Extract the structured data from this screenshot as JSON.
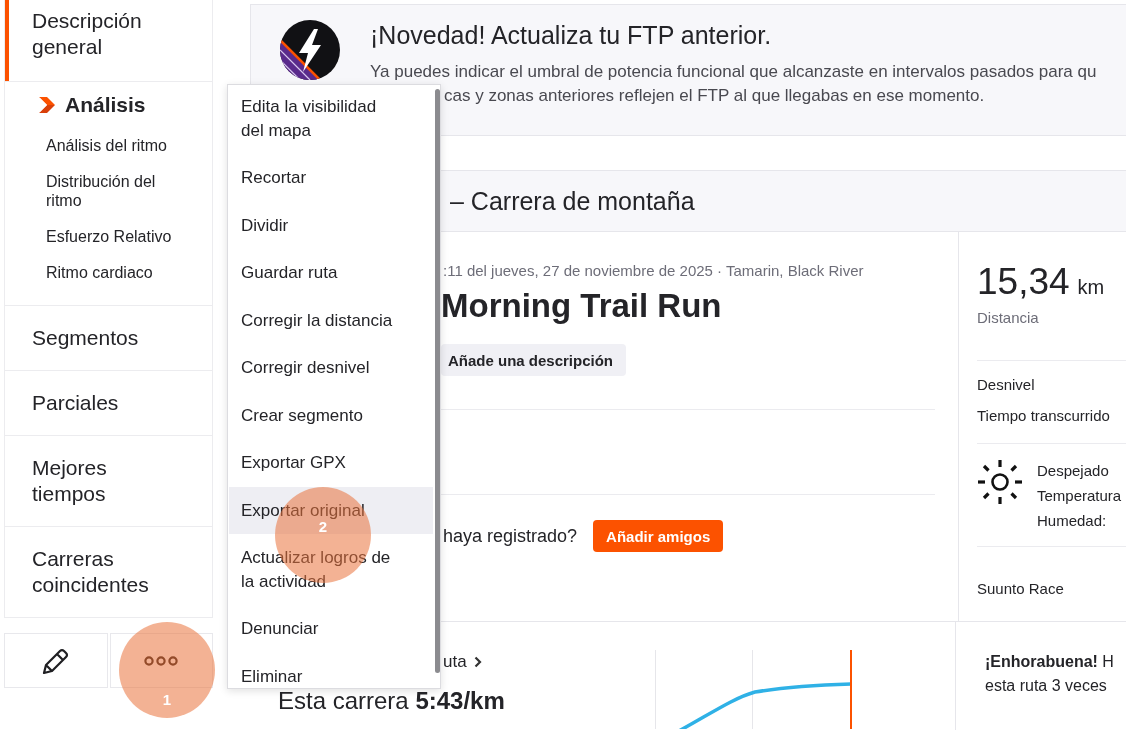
{
  "sidebar": {
    "items": [
      {
        "label": "Descripción general",
        "selected": true
      },
      {
        "label": "Análisis",
        "selected": false,
        "children": [
          {
            "label": "Análisis del ritmo",
            "selected": false
          },
          {
            "label": "Distribución del ritmo",
            "selected": false
          },
          {
            "label": "Esfuerzo Relativo",
            "selected": false
          },
          {
            "label": "Ritmo cardiaco",
            "selected": false
          }
        ]
      },
      {
        "label": "Segmentos",
        "selected": false
      },
      {
        "label": "Parciales",
        "selected": false
      },
      {
        "label": "Mejores tiempos",
        "selected": false
      },
      {
        "label": "Carreras coincidentes",
        "selected": false
      }
    ]
  },
  "banner": {
    "title": "¡Novedad! Actualiza tu FTP anterior.",
    "lines": [
      "Ya puedes indicar el umbral de potencia funcional que alcanzaste en intervalos pasados para qu",
      "cas y zonas anteriores reflejen el FTP al que llegabas en ese momento."
    ]
  },
  "activity": {
    "type": "– Carrera de montaña",
    "meta": ":11 del jueves, 27 de noviembre de 2025 · Tamarin, Black River",
    "title": "Morning Trail Run",
    "description_button": "Añade una descripción",
    "friends_prompt": "haya registrado?",
    "friends_button": "Añadir amigos"
  },
  "stats": {
    "distance": "15,34",
    "distance_unit": "km",
    "distance_label": "Distancia",
    "labels": [
      "Desnivel",
      "Tiempo transcurrido"
    ],
    "weather": [
      "Despejado",
      "Temperatura",
      "Humedad:"
    ],
    "device": "Suunto Race"
  },
  "route": {
    "link": "uta",
    "pace": "Esta carrera **5:43/km**"
  },
  "congrats": {
    "lines": [
      "**¡Enhorabuena!** H",
      "esta ruta 3 veces"
    ]
  },
  "menu": {
    "items": [
      {
        "label": "Edita la visibilidad del mapa",
        "selected": false
      },
      {
        "label": "Recortar",
        "selected": false
      },
      {
        "label": "Dividir",
        "selected": false
      },
      {
        "label": "Guardar ruta",
        "selected": false
      },
      {
        "label": "Corregir la distancia",
        "selected": false
      },
      {
        "label": "Corregir desnivel",
        "selected": false
      },
      {
        "label": "Crear segmento",
        "selected": false
      },
      {
        "label": "Exportar GPX",
        "selected": false
      },
      {
        "label": "Exportar original",
        "selected": true
      },
      {
        "label": "Actualizar logros de la actividad",
        "selected": false
      },
      {
        "label": "Denunciar",
        "selected": false
      },
      {
        "label": "Eliminar",
        "selected": false
      }
    ]
  },
  "step_markers": [
    {
      "label": "1"
    },
    {
      "label": "2"
    }
  ]
}
